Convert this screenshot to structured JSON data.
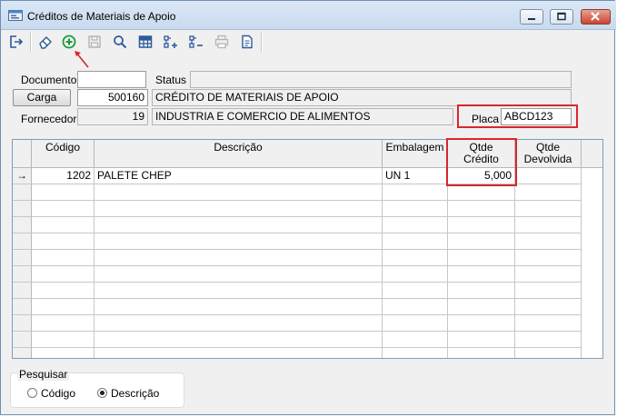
{
  "window": {
    "title": "Créditos de Materiais de Apoio"
  },
  "toolbar": {
    "buttons": [
      {
        "name": "exit-icon",
        "enabled": true
      },
      {
        "name": "eraser-icon",
        "enabled": true
      },
      {
        "name": "add-circle-icon",
        "enabled": true
      },
      {
        "name": "save-icon",
        "enabled": false
      },
      {
        "name": "search-icon",
        "enabled": true
      },
      {
        "name": "table-icon",
        "enabled": true
      },
      {
        "name": "add-item-icon",
        "enabled": true
      },
      {
        "name": "remove-item-icon",
        "enabled": true
      },
      {
        "name": "print-icon",
        "enabled": false
      },
      {
        "name": "document-icon",
        "enabled": true
      }
    ]
  },
  "form": {
    "documento_label": "Documento",
    "documento_value": "",
    "status_label": "Status",
    "status_value": "",
    "carga_button": "Carga",
    "carga_value": "500160",
    "carga_desc": "CRÉDITO DE MATERIAIS DE APOIO",
    "fornecedor_label": "Fornecedor",
    "fornecedor_code": "19",
    "fornecedor_name": "INDUSTRIA E COMERCIO DE ALIMENTOS",
    "placa_label": "Placa",
    "placa_value": "ABCD123"
  },
  "grid": {
    "columns": [
      "Código",
      "Descrição",
      "Embalagem",
      "Qtde\nCrédito",
      "Qtde\nDevolvida"
    ],
    "rows": [
      {
        "indicator": "→",
        "codigo": "1202",
        "descricao": "PALETE CHEP",
        "embalagem": "UN 1",
        "qtde_credito": "5,000",
        "qtde_devolvida": ""
      }
    ]
  },
  "search": {
    "title": "Pesquisar",
    "options": [
      {
        "label": "Código",
        "selected": false
      },
      {
        "label": "Descrição",
        "selected": true
      }
    ]
  },
  "colors": {
    "highlight": "#d9262b",
    "add_icon": "#1a9b3a",
    "arrow": "#d9262b"
  }
}
